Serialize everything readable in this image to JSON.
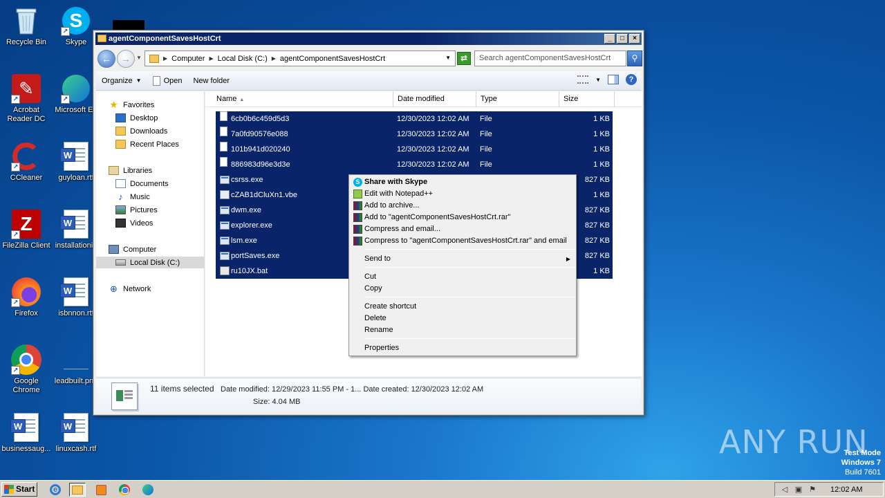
{
  "desktop": {
    "icons": [
      {
        "label": "Recycle Bin",
        "icon": "recycle-bin-icon"
      },
      {
        "label": "Skype",
        "icon": "skype-icon"
      },
      {
        "label": "Acrobat Reader DC",
        "icon": "acrobat-icon"
      },
      {
        "label": "Microsoft Ed",
        "icon": "edge-icon"
      },
      {
        "label": "CCleaner",
        "icon": "ccleaner-icon"
      },
      {
        "label": "guyloan.rtf",
        "icon": "word-document-icon"
      },
      {
        "label": "FileZilla Client",
        "icon": "filezilla-icon"
      },
      {
        "label": "installationio",
        "icon": "word-document-icon"
      },
      {
        "label": "Firefox",
        "icon": "firefox-icon"
      },
      {
        "label": "isbnnon.rtf",
        "icon": "word-document-icon"
      },
      {
        "label": "Google Chrome",
        "icon": "chrome-icon"
      },
      {
        "label": "leadbuilt.png",
        "icon": "image-icon"
      },
      {
        "label": "businessaug...",
        "icon": "word-document-icon"
      },
      {
        "label": "linuxcash.rtf",
        "icon": "word-document-icon"
      }
    ]
  },
  "window": {
    "title": "agentComponentSavesHostCrt",
    "controls": {
      "minimize": "_",
      "maximize": "□",
      "close": "×"
    },
    "address": {
      "crumbs": [
        "Computer",
        "Local Disk (C:)",
        "agentComponentSavesHostCrt"
      ]
    },
    "search_placeholder": "Search agentComponentSavesHostCrt",
    "toolbar": {
      "organize": "Organize",
      "open": "Open",
      "new_folder": "New folder"
    },
    "nav": {
      "favorites": "Favorites",
      "desktop": "Desktop",
      "downloads": "Downloads",
      "recent": "Recent Places",
      "libraries": "Libraries",
      "documents": "Documents",
      "music": "Music",
      "pictures": "Pictures",
      "videos": "Videos",
      "computer": "Computer",
      "local_disk": "Local Disk (C:)",
      "network": "Network"
    },
    "columns": {
      "name": "Name",
      "date": "Date modified",
      "type": "Type",
      "size": "Size"
    },
    "files": [
      {
        "name": "6cb0b6c459d5d3",
        "date": "12/30/2023 12:02 AM",
        "type": "File",
        "size": "1 KB",
        "kind": "file"
      },
      {
        "name": "7a0fd90576e088",
        "date": "12/30/2023 12:02 AM",
        "type": "File",
        "size": "1 KB",
        "kind": "file"
      },
      {
        "name": "101b941d020240",
        "date": "12/30/2023 12:02 AM",
        "type": "File",
        "size": "1 KB",
        "kind": "file"
      },
      {
        "name": "886983d96e3d3e",
        "date": "12/30/2023 12:02 AM",
        "type": "File",
        "size": "1 KB",
        "kind": "file"
      },
      {
        "name": "csrss.exe",
        "date": "",
        "type": "",
        "size": "827 KB",
        "kind": "exe"
      },
      {
        "name": "cZAB1dCluXn1.vbe",
        "date": "",
        "type": "",
        "size": "1 KB",
        "kind": "vbs"
      },
      {
        "name": "dwm.exe",
        "date": "",
        "type": "",
        "size": "827 KB",
        "kind": "exe"
      },
      {
        "name": "explorer.exe",
        "date": "",
        "type": "",
        "size": "827 KB",
        "kind": "exe"
      },
      {
        "name": "lsm.exe",
        "date": "",
        "type": "",
        "size": "827 KB",
        "kind": "exe"
      },
      {
        "name": "portSaves.exe",
        "date": "",
        "type": "",
        "size": "827 KB",
        "kind": "exe"
      },
      {
        "name": "ru10JX.bat",
        "date": "",
        "type": "",
        "size": "1 KB",
        "kind": "bat"
      }
    ],
    "details": {
      "count": "11 items selected",
      "line1": "Date modified: 12/29/2023 11:55 PM - 1...  Date created: 12/30/2023 12:02 AM",
      "line2": "Size: 4.04 MB"
    }
  },
  "context_menu": {
    "share_skype": "Share with Skype",
    "edit_npp": "Edit with Notepad++",
    "add_archive": "Add to archive...",
    "add_rar": "Add to \"agentComponentSavesHostCrt.rar\"",
    "compress_email": "Compress and email...",
    "compress_rar_email": "Compress to \"agentComponentSavesHostCrt.rar\" and email",
    "send_to": "Send to",
    "cut": "Cut",
    "copy": "Copy",
    "create_shortcut": "Create shortcut",
    "delete": "Delete",
    "rename": "Rename",
    "properties": "Properties"
  },
  "taskbar": {
    "start": "Start",
    "clock": "12:02 AM"
  },
  "watermark": "ANY RUN",
  "test_mode": {
    "line1": "Test Mode",
    "line2": "Windows 7",
    "line3": "Build 7601"
  },
  "colors": {
    "selection": "#0a246a",
    "title_bar": "#0a246a",
    "desktop": "#0b56a8"
  }
}
